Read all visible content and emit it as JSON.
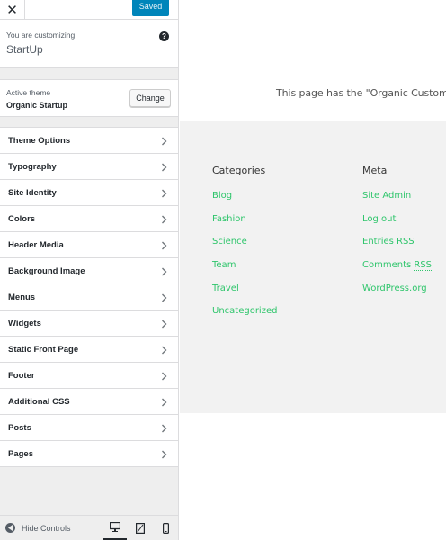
{
  "colors": {
    "accent": "#0085ba",
    "link": "#2ec56b"
  },
  "topbar": {
    "close_icon": "close-icon",
    "saved_label": "Saved"
  },
  "info": {
    "label": "You are customizing",
    "title": "StartUp",
    "help_icon": "help-icon"
  },
  "theme": {
    "label": "Active theme",
    "name": "Organic Startup",
    "change_label": "Change"
  },
  "menu": [
    "Theme Options",
    "Typography",
    "Site Identity",
    "Colors",
    "Header Media",
    "Background Image",
    "Menus",
    "Widgets",
    "Static Front Page",
    "Footer",
    "Additional CSS",
    "Posts",
    "Pages"
  ],
  "footer": {
    "hide_label": "Hide Controls",
    "devices": [
      "desktop-icon",
      "tablet-icon",
      "mobile-icon"
    ]
  },
  "preview": {
    "text": "This page has the \"Organic Custom\"",
    "categories": {
      "title": "Categories",
      "links": [
        "Blog",
        "Fashion",
        "Science",
        "Team",
        "Travel",
        "Uncategorized"
      ]
    },
    "meta": {
      "title": "Meta",
      "links": [
        {
          "pre": "Site Admin",
          "abbr": ""
        },
        {
          "pre": "Log out",
          "abbr": ""
        },
        {
          "pre": "Entries ",
          "abbr": "RSS"
        },
        {
          "pre": "Comments ",
          "abbr": "RSS"
        },
        {
          "pre": "WordPress.org",
          "abbr": ""
        }
      ]
    }
  }
}
